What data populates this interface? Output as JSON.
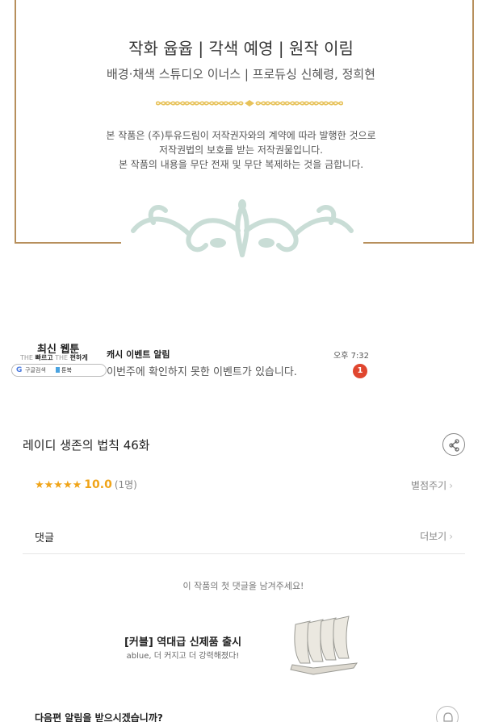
{
  "credits": {
    "title": "작화 윱윱 | 각색 예영 | 원작 이림",
    "subtitle": "배경·채색 스튜디오 이너스 | 프로듀싱 신혜령, 정희현",
    "notice": [
      "본 작품은 (주)투유드림이 저작권자와의 계약에 따라 발행한 것으로",
      "저작권법의 보호를 받는 저작권물입니다.",
      "본 작품의 내용을 무단 전재 및 무단 복제하는 것을 금합니다."
    ],
    "frame_color": "#b78f5c",
    "ornament_color": "#e7c25a",
    "flourish_color": "#c9ddd6"
  },
  "ad_banner": {
    "brand": "최신 웹툰",
    "tagline_prefix": "THE",
    "tagline_fast": "빠르고",
    "tagline_mid": "THE",
    "tagline_easy": "편하게",
    "search_label": "구글검색",
    "book_label": "툰북",
    "heading": "캐시 이벤트 알림",
    "body": "이번주에 확인하지 못한 이벤트가 있습니다.",
    "time": "오후 7:32",
    "badge_count": "1"
  },
  "episode": {
    "title": "레이디 생존의 법칙 46화",
    "stars": "★★★★★",
    "score": "10.0",
    "rating_count": "(1명)",
    "rate_label": "별점주기",
    "chevron": "›",
    "accent_color": "#f0a418"
  },
  "comments": {
    "label": "댓글",
    "more_label": "더보기",
    "empty_message": "이 작품의 첫 댓글을 남겨주세요!"
  },
  "product_ad": {
    "title": "[커블] 역대급 신제품 출시",
    "description": "ablue, 더 커지고 더 강력해졌다!"
  },
  "next_episode": {
    "prompt": "다음편 알림을 받으시겠습니까?"
  },
  "icons": {
    "share": "share-icon",
    "bell": "bell-icon",
    "google": "G"
  }
}
